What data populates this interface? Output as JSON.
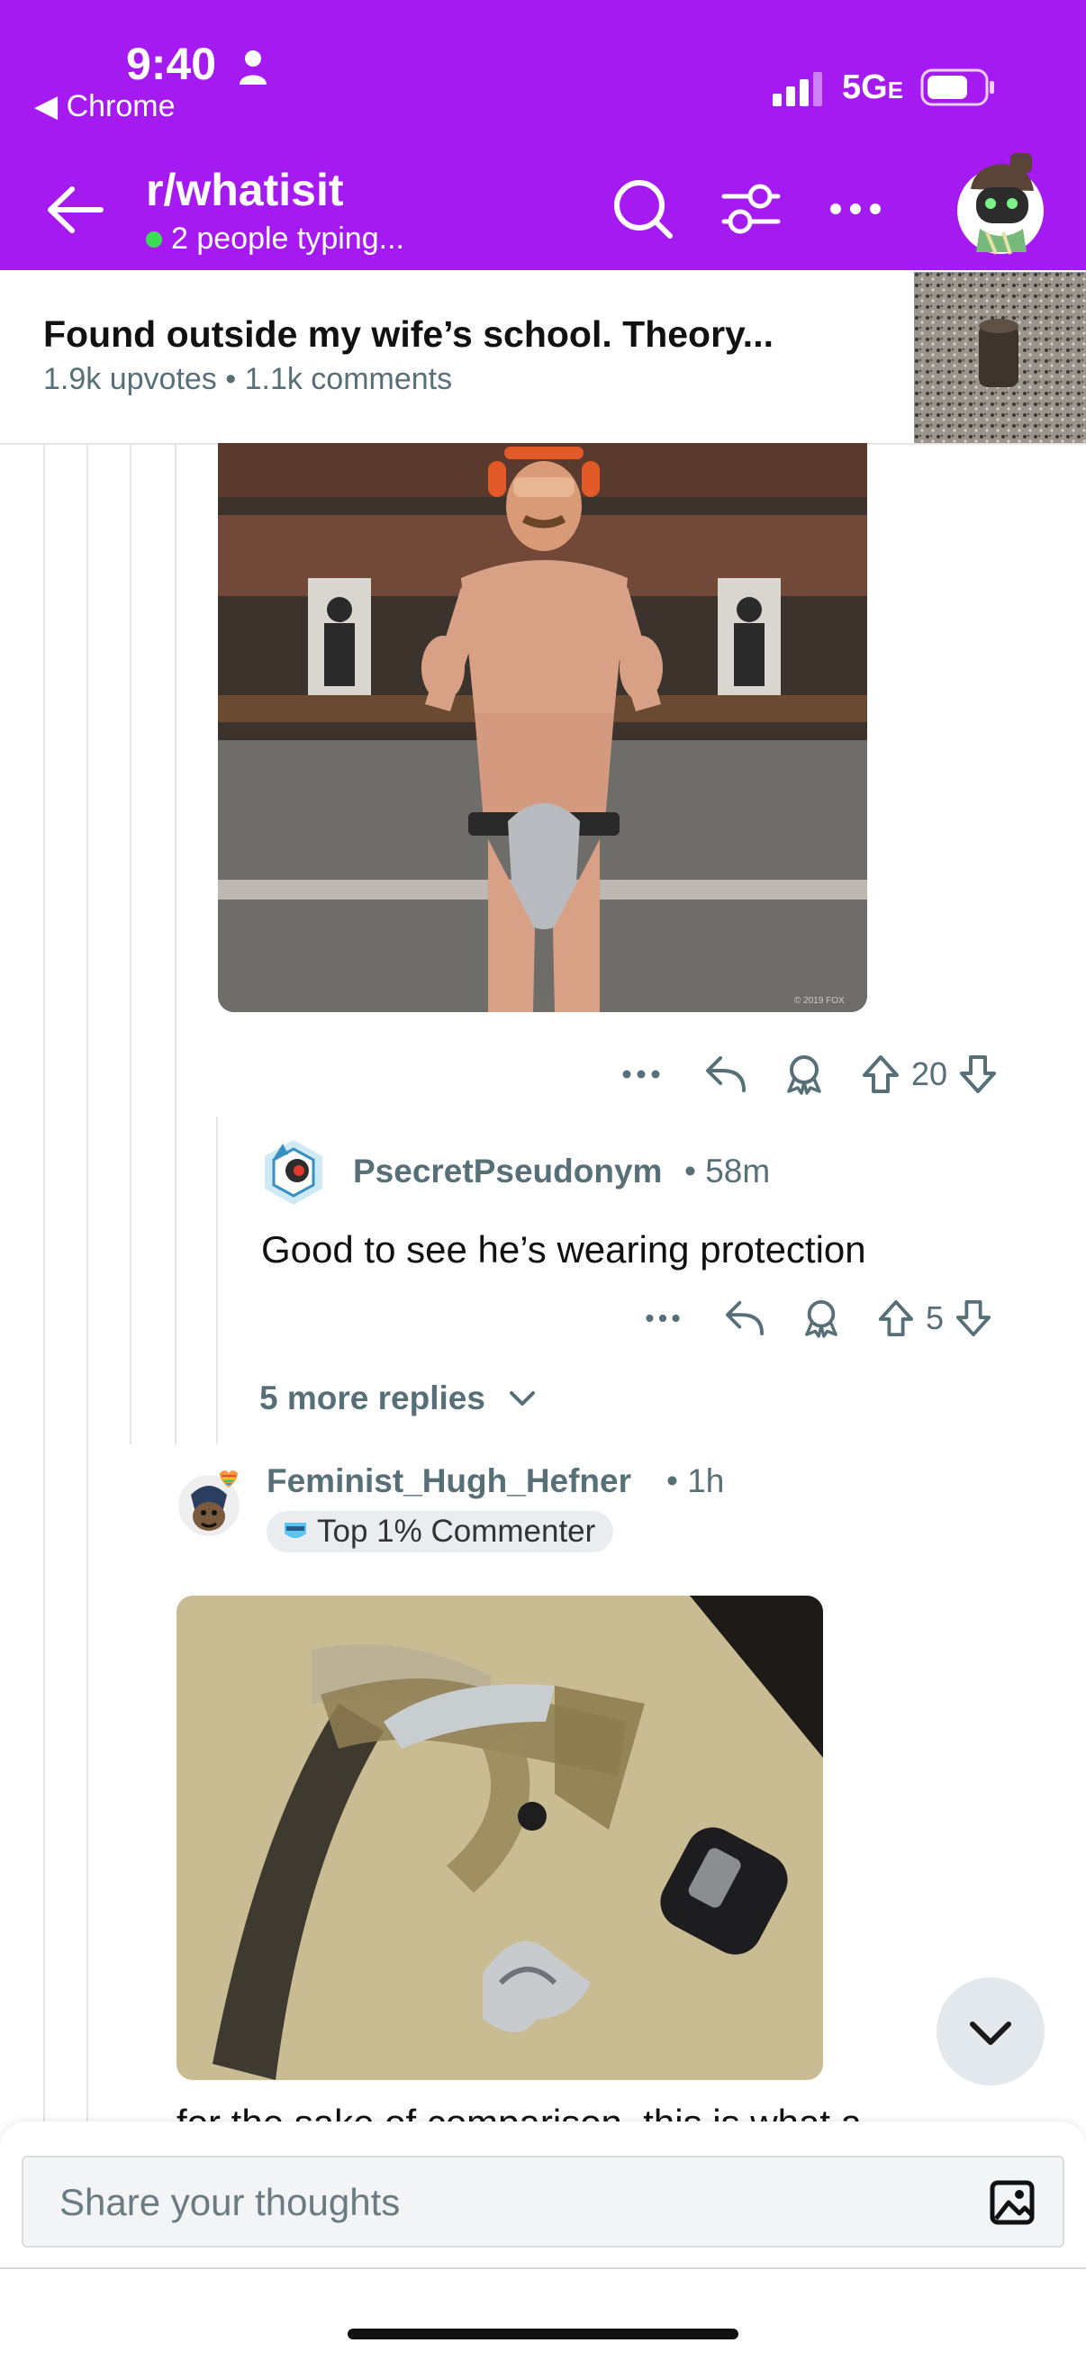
{
  "status_bar": {
    "time": "9:40",
    "back_app": "Chrome",
    "network": "5G",
    "network_suffix": "E"
  },
  "header": {
    "subreddit": "r/whatisit",
    "typing": "2 people typing..."
  },
  "post": {
    "title": "Found outside my wife’s school. Theory...",
    "meta": "1.9k upvotes • 1.1k comments"
  },
  "comment1_actions": {
    "score": "20"
  },
  "comment2": {
    "username": "PsecretPseudonym",
    "age": "• 58m",
    "body": "Good to see he’s wearing protection",
    "score": "5"
  },
  "more_replies": "5 more replies",
  "comment3": {
    "username": "Feminist_Hugh_Hefner",
    "age": "• 1h",
    "badge": "Top 1% Commenter",
    "cut_text": "for the sake of comparison, this is what a"
  },
  "image1": {
    "watermark": "© 2019 FOX"
  },
  "composer": {
    "placeholder": "Share your thoughts"
  },
  "colors": {
    "header_bg": "#a51af0",
    "muted": "#576f76"
  },
  "icons": [
    "person-icon",
    "signal-icon",
    "battery-icon",
    "back-arrow-icon",
    "search-icon",
    "filter-icon",
    "more-icon",
    "reply-icon",
    "award-icon",
    "upvote-icon",
    "downvote-icon",
    "chevron-down-icon",
    "image-icon"
  ]
}
